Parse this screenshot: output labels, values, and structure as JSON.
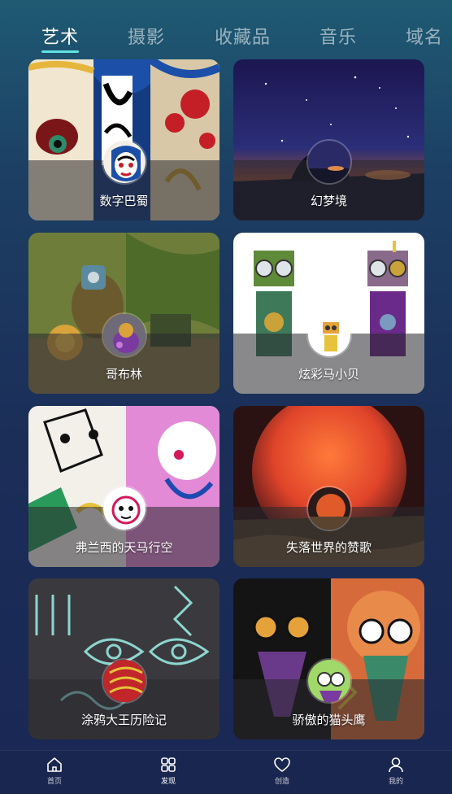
{
  "tabs": [
    {
      "label": "艺术",
      "active": true
    },
    {
      "label": "摄影",
      "active": false
    },
    {
      "label": "收藏品",
      "active": false
    },
    {
      "label": "音乐",
      "active": false
    },
    {
      "label": "域名",
      "active": false
    }
  ],
  "cards": [
    {
      "title": "数字巴蜀"
    },
    {
      "title": "幻梦境"
    },
    {
      "title": "哥布林"
    },
    {
      "title": "炫彩马小贝"
    },
    {
      "title": "弗兰西的天马行空"
    },
    {
      "title": "失落世界的赞歌"
    },
    {
      "title": "涂鸦大王历险记"
    },
    {
      "title": "骄傲的猫头鹰"
    }
  ],
  "bottom_nav": [
    {
      "label": "首页",
      "icon": "home-icon"
    },
    {
      "label": "发现",
      "icon": "grid-icon",
      "active": true
    },
    {
      "label": "创造",
      "icon": "heart-icon"
    },
    {
      "label": "我的",
      "icon": "user-icon"
    }
  ],
  "colors": {
    "accent": "#5fe3e0",
    "background": "#1b2e58"
  }
}
